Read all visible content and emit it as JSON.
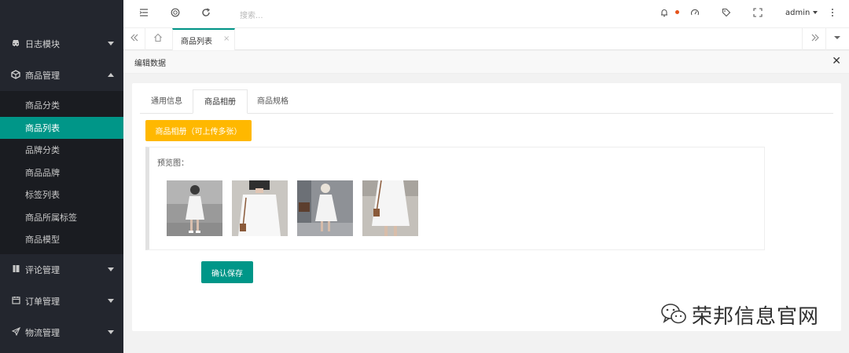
{
  "sidebar": {
    "groups": [
      {
        "label": "日志模块",
        "icon": "car-icon",
        "expanded": false
      },
      {
        "label": "商品管理",
        "icon": "box-icon",
        "expanded": true,
        "items": [
          "商品分类",
          "商品列表",
          "品牌分类",
          "商品品牌",
          "标签列表",
          "商品所属标签",
          "商品模型"
        ],
        "active_index": 1
      },
      {
        "label": "评论管理",
        "icon": "book-icon",
        "expanded": false
      },
      {
        "label": "订单管理",
        "icon": "calendar-icon",
        "expanded": false
      },
      {
        "label": "物流管理",
        "icon": "send-icon",
        "expanded": false
      }
    ]
  },
  "header": {
    "search_placeholder": "搜索...",
    "user": "admin"
  },
  "tabbar": {
    "active_tab": "商品列表",
    "close_glyph": "×"
  },
  "edit": {
    "title": "编辑数据",
    "close_glyph": "✕"
  },
  "form": {
    "tabs": [
      "通用信息",
      "商品相册",
      "商品规格"
    ],
    "active_tab_index": 1,
    "upload_button": "商品相册（可上传多张）",
    "preview_label": "预览图：",
    "images": [
      "dress-photo-1",
      "dress-photo-2",
      "dress-photo-3",
      "dress-photo-4"
    ],
    "save_button": "确认保存"
  },
  "watermark": {
    "text": "荣邦信息官网"
  },
  "colors": {
    "sidebar_bg": "#23262e",
    "accent": "#009688",
    "warning": "#ffb800",
    "notification_dot": "#e5531b"
  }
}
